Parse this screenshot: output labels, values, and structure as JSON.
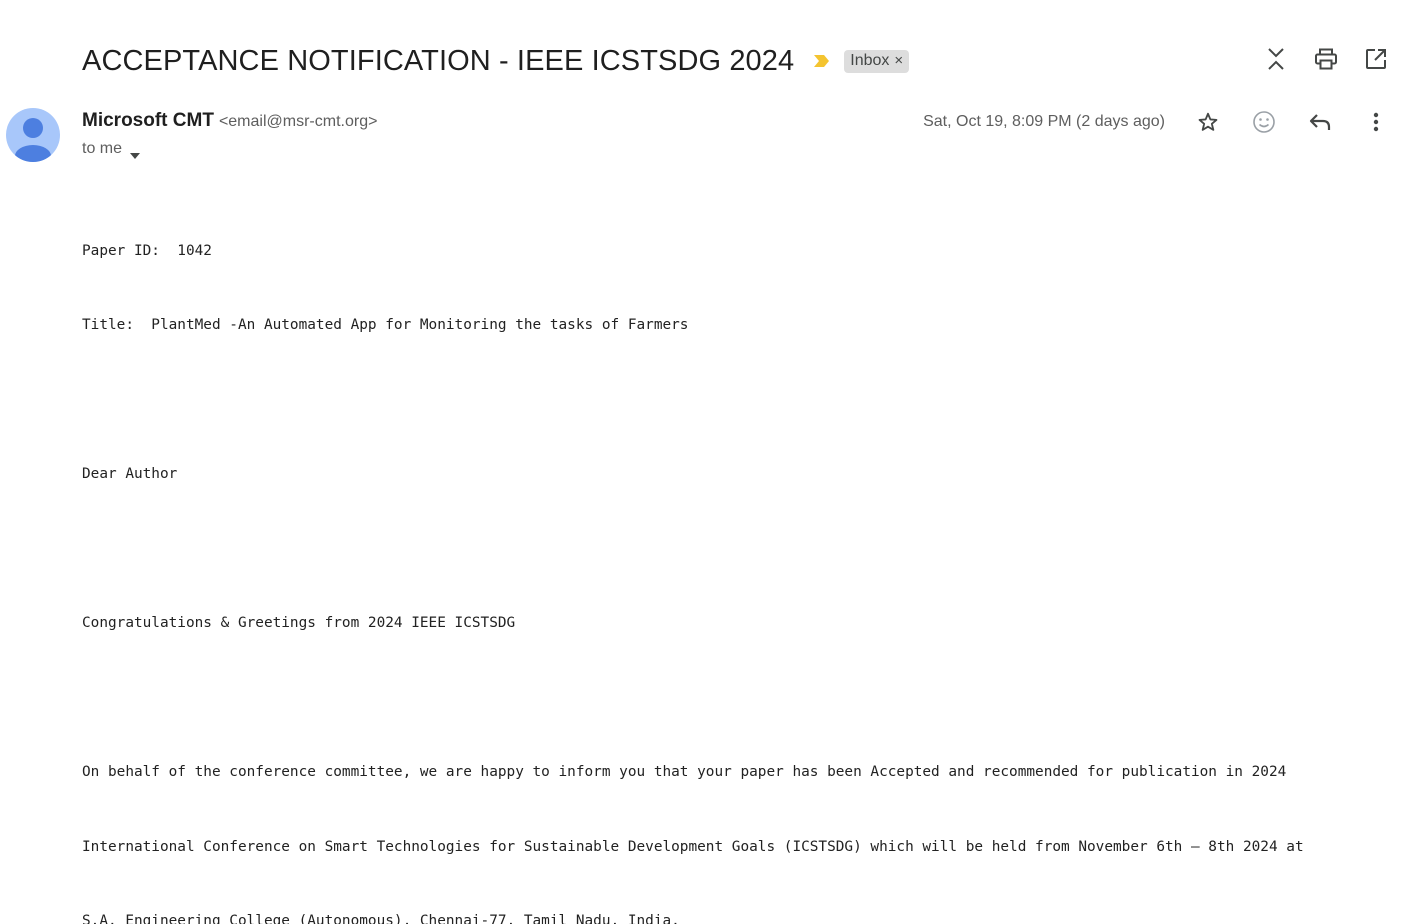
{
  "email": {
    "subject": "ACCEPTANCE NOTIFICATION - IEEE ICSTSDG 2024",
    "label": "Inbox",
    "label_remove": "×",
    "sender_name": "Microsoft CMT",
    "sender_email": "<email@msr-cmt.org>",
    "recipient": "to me",
    "date": "Sat, Oct 19, 8:09 PM (2 days ago)",
    "body_lines": [
      "Paper ID:  1042",
      "Title:  PlantMed -An Automated App for Monitoring the tasks of Farmers",
      "",
      "Dear Author",
      "",
      "Congratulations & Greetings from 2024 IEEE ICSTSDG",
      "",
      "On behalf of the conference committee, we are happy to inform you that your paper has been Accepted and recommended for publication in 2024",
      "International Conference on Smart Technologies for Sustainable Development Goals (ICSTSDG) which will be held from November 6th – 8th 2024 at",
      "S.A. Engineering College (Autonomous), Chennai-77, Tamil Nadu, India."
    ]
  },
  "icons": {
    "importance": "importance-marker-icon",
    "expand_collapse": "expand-collapse-icon",
    "print": "print-icon",
    "open_new_window": "open-in-new-window-icon",
    "star": "star-icon",
    "emoji": "emoji-react-icon",
    "reply": "reply-icon",
    "more": "more-vert-icon",
    "avatar": "person-avatar-icon",
    "caret": "caret-down-icon"
  },
  "colors": {
    "importance": "#f4c430",
    "avatar_bg": "#a8c7fa",
    "avatar_fg": "#4d7fe0",
    "chip_bg": "#dddddd",
    "icon": "#444746"
  }
}
